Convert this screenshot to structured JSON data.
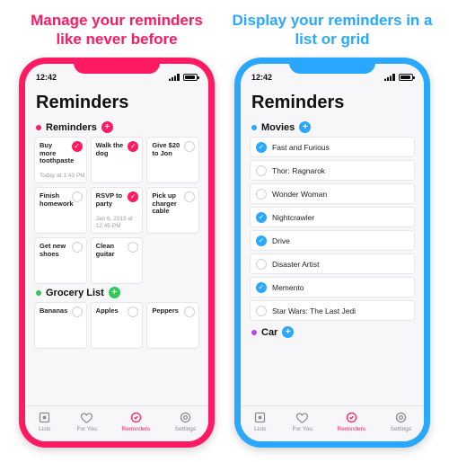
{
  "panels": [
    {
      "headline": "Manage your reminders like never before",
      "accent": "pink",
      "statusTime": "12:42",
      "title": "Reminders",
      "layout": "grid",
      "sections": [
        {
          "name": "Reminders",
          "dot": "pink",
          "plus": "pink",
          "items": [
            {
              "label": "Buy more toothpaste",
              "done": true,
              "meta": "Today at 1:43 PM"
            },
            {
              "label": "Walk the dog",
              "done": true,
              "meta": ""
            },
            {
              "label": "Give $20 to Jon",
              "done": false,
              "meta": ""
            },
            {
              "label": "Finish homework",
              "done": false,
              "meta": ""
            },
            {
              "label": "RSVP to party",
              "done": true,
              "meta": "Jan 6, 2019 at 12:45 PM"
            },
            {
              "label": "Pick up charger cable",
              "done": false,
              "meta": ""
            },
            {
              "label": "Get new shoes",
              "done": false,
              "meta": ""
            },
            {
              "label": "Clean guitar",
              "done": false,
              "meta": ""
            }
          ]
        },
        {
          "name": "Grocery List",
          "dot": "green",
          "plus": "green",
          "items": [
            {
              "label": "Bananas",
              "done": false,
              "meta": ""
            },
            {
              "label": "Apples",
              "done": false,
              "meta": ""
            },
            {
              "label": "Peppers",
              "done": false,
              "meta": ""
            }
          ]
        }
      ]
    },
    {
      "headline": "Display your reminders in a list or grid",
      "accent": "blue",
      "statusTime": "12:42",
      "title": "Reminders",
      "layout": "list",
      "sections": [
        {
          "name": "Movies",
          "dot": "blue",
          "plus": "blue",
          "items": [
            {
              "label": "Fast and Furious",
              "done": true
            },
            {
              "label": "Thor: Ragnarok",
              "done": false
            },
            {
              "label": "Wonder Woman",
              "done": false
            },
            {
              "label": "Nightcrawler",
              "done": true
            },
            {
              "label": "Drive",
              "done": true
            },
            {
              "label": "Disaster Artist",
              "done": false
            },
            {
              "label": "Memento",
              "done": true
            },
            {
              "label": "Star Wars: The Last Jedi",
              "done": false
            }
          ]
        },
        {
          "name": "Car",
          "dot": "purple",
          "plus": "blue",
          "items": []
        }
      ]
    }
  ],
  "tabs": [
    {
      "label": "Lists",
      "icon": "list-icon",
      "active": false
    },
    {
      "label": "For You",
      "icon": "heart-icon",
      "active": false
    },
    {
      "label": "Reminders",
      "icon": "reminders-icon",
      "active": true
    },
    {
      "label": "Settings",
      "icon": "gear-icon",
      "active": false
    }
  ]
}
